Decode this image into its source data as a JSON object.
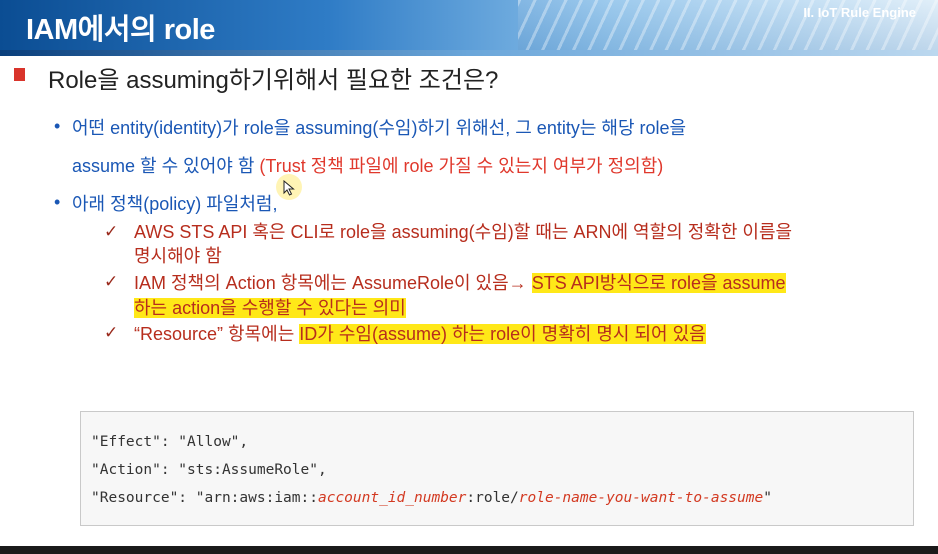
{
  "header": {
    "title": "IAM에서의 role",
    "chapter": "II. IoT Rule Engine"
  },
  "heading": "Role을 assuming하기위해서 필요한 조건은?",
  "bullets": [
    {
      "line1": "어떤 entity(identity)가 role을 assuming(수임)하기 위해선, 그 entity는 해당 role을",
      "line2_plain": "assume 할 수 있어야 함 ",
      "line2_red": "(Trust 정책 파일에 role 가질 수 있는지 여부가 정의함)"
    },
    {
      "text": "아래 정책(policy) 파일처럼,"
    }
  ],
  "checks": [
    {
      "line1": "AWS STS API 혹은 CLI로 role을 assuming(수임)할 때는 ARN에 역할의 정확한 이름을",
      "line2": "명시해야 함"
    },
    {
      "plain": "IAM 정책의 Action 항목에는 AssumeRole이 있음→ ",
      "highlight1": "STS API방식으로 role을 assume",
      "highlight2": "하는 action을 수행할 수 있다는 의미"
    },
    {
      "plain": "“Resource” 항목에는 ",
      "highlight": "ID가 수임(assume) 하는 role이 명확히 명시 되어 있음"
    }
  ],
  "code": {
    "effect": "\"Effect\": \"Allow\",",
    "action": "\"Action\": \"sts:AssumeRole\",",
    "resource_prefix": "\"Resource\": \"arn:aws:iam::",
    "resource_account": "account_id_number",
    "resource_mid": ":role/",
    "resource_role": "role-name-you-want-to-assume",
    "resource_suffix": "\""
  },
  "icons": {
    "bullet": "•",
    "check": "✓",
    "heading_marker": "red-square-icon",
    "cursor": "mouse-pointer-icon"
  },
  "colors": {
    "blue_text": "#1a57b5",
    "red_text": "#e0382c",
    "check_text": "#b72d1d",
    "highlight": "#ffe818"
  }
}
